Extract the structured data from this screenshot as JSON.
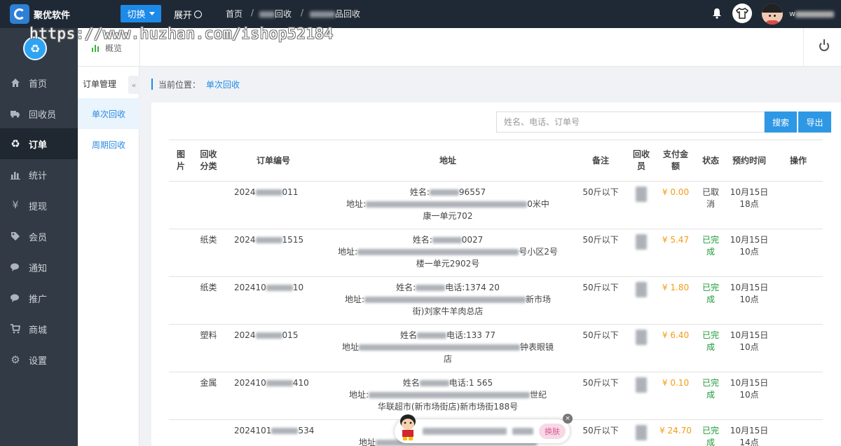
{
  "topbar": {
    "brand": "聚优软件",
    "switch_label": "切换",
    "expand_label": "展开",
    "breadcrumbs": [
      "首页",
      "回收",
      "品回收"
    ],
    "username_suffix": "w"
  },
  "watermark": "https://www.huzhan.com/ishop52184",
  "sidebar": {
    "items": [
      {
        "label": "首页",
        "icon": "home-icon"
      },
      {
        "label": "回收员",
        "icon": "truck-icon"
      },
      {
        "label": "订单",
        "icon": "recycle-icon"
      },
      {
        "label": "统计",
        "icon": "bar-chart-icon"
      },
      {
        "label": "提现",
        "icon": "yen-icon"
      },
      {
        "label": "会员",
        "icon": "tag-icon"
      },
      {
        "label": "通知",
        "icon": "chat-icon"
      },
      {
        "label": "推广",
        "icon": "chat-icon"
      },
      {
        "label": "商城",
        "icon": "cart-icon"
      },
      {
        "label": "设置",
        "icon": "gear-icon"
      }
    ],
    "active_index": 2
  },
  "overview_label": "概览",
  "subnav": {
    "title": "订单管理",
    "collapse_glyph": "«",
    "items": [
      {
        "label": "单次回收",
        "active": true
      },
      {
        "label": "周期回收",
        "active": false
      }
    ]
  },
  "location": {
    "prefix": "当前位置：",
    "current": "单次回收"
  },
  "search": {
    "placeholder": "姓名、电话、订单号",
    "search_label": "搜索",
    "export_label": "导出"
  },
  "table": {
    "headers": [
      "图片",
      "回收分类",
      "订单编号",
      "地址",
      "备注",
      "回收员",
      "支付金额",
      "状态",
      "预约时间",
      "操作"
    ],
    "rows": [
      {
        "category": "",
        "order_prefix": "2024",
        "order_suffix": "011",
        "name_line_a": "姓名:",
        "name_line_b": "96557",
        "addr_a": "地址:",
        "addr_b": "0米中",
        "addr_c": "康",
        "addr_d": "一单元702",
        "note": "50斤以下",
        "amount": "¥ 0.00",
        "status_1": "已取",
        "status_2": "消",
        "time_1": "10月15日",
        "time_2": "18点",
        "status_done": false
      },
      {
        "category": "纸类",
        "order_prefix": "2024",
        "order_suffix": "1515",
        "name_line_a": "姓名:",
        "name_line_b": "0027",
        "addr_a": "地址:",
        "addr_b": "号小区2号",
        "addr_c": "",
        "addr_d": "楼一单元2902号",
        "note": "50斤以下",
        "amount": "¥ 5.47",
        "status_1": "已完",
        "status_2": "成",
        "time_1": "10月15日",
        "time_2": "10点",
        "status_done": true
      },
      {
        "category": "纸类",
        "order_prefix": "202410",
        "order_suffix": "10",
        "name_line_a": "姓名:",
        "name_line_b": "电话:1374  20",
        "addr_a": "地址:",
        "addr_b": "新市场",
        "addr_c": "",
        "addr_d": "街)刘家牛羊肉总店",
        "note": "50斤以下",
        "amount": "¥ 1.80",
        "status_1": "已完",
        "status_2": "成",
        "time_1": "10月15日",
        "time_2": "10点",
        "status_done": true
      },
      {
        "category": "塑料",
        "order_prefix": "2024",
        "order_suffix": "015",
        "name_line_a": "姓名",
        "name_line_b": "电话:133  77",
        "addr_a": "地址",
        "addr_b": "钟表眼镜",
        "addr_c": "",
        "addr_d": "店",
        "note": "50斤以下",
        "amount": "¥ 6.40",
        "status_1": "已完",
        "status_2": "成",
        "time_1": "10月15日",
        "time_2": "10点",
        "status_done": true
      },
      {
        "category": "金属",
        "order_prefix": "202410",
        "order_suffix": "410",
        "name_line_a": "姓名",
        "name_line_b": "电话:1  565",
        "addr_a": "地址:",
        "addr_b": "世纪",
        "addr_c": "",
        "addr_d": "华联超市(新市场街店)新市场街188号",
        "note": "50斤以下",
        "amount": "¥ 0.10",
        "status_1": "已完",
        "status_2": "成",
        "time_1": "10月15日",
        "time_2": "10点",
        "status_done": true
      },
      {
        "category": "",
        "order_prefix": "2024101",
        "order_suffix": "534",
        "name_line_a": "",
        "name_line_b": "",
        "addr_a": "地址",
        "addr_b": "",
        "addr_c": "",
        "addr_d": "",
        "note": "50斤以下",
        "amount": "¥ 24.70",
        "status_1": "已完",
        "status_2": "成",
        "time_1": "10月15日",
        "time_2": "14点",
        "status_done": true
      }
    ]
  },
  "float_ad": {
    "swap_label": "换肤",
    "close_glyph": "×"
  },
  "colors": {
    "accent": "#1e8ae8",
    "topbar": "#1f2935",
    "sidebar": "#323b45",
    "money": "#f39c12",
    "done": "#1a9a35"
  }
}
